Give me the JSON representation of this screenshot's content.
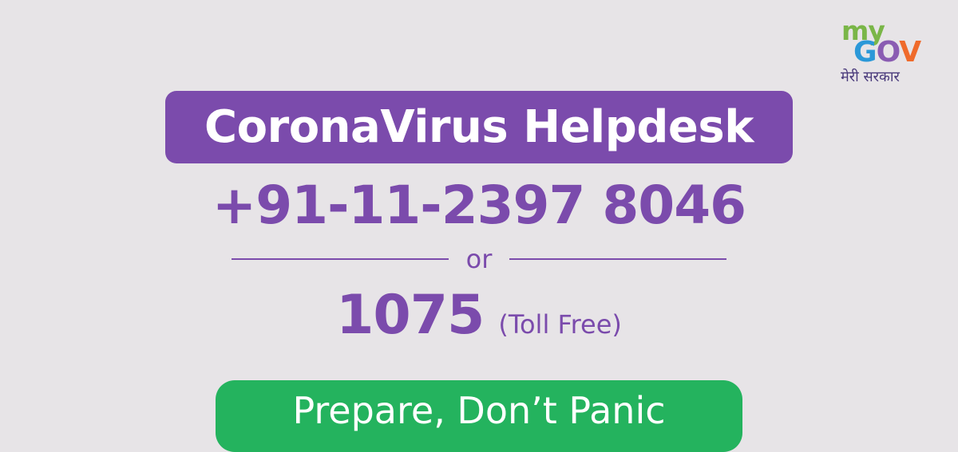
{
  "colors": {
    "background": "#e7e4e7",
    "purple": "#7b4bac",
    "green": "#24b35e",
    "logo_my": "#7ab648",
    "logo_g": "#2b98d8",
    "logo_o": "#8a5cb2",
    "logo_v": "#ef6a2b"
  },
  "logo": {
    "my": "my",
    "gov_g": "G",
    "gov_o": "O",
    "gov_v": "V",
    "hindi": "मेरी सरकार"
  },
  "title": "CoronaVirus Helpdesk",
  "phone": "+91-11-2397 8046",
  "separator": "or",
  "toll_free": {
    "number": "1075",
    "note": "(Toll Free)"
  },
  "slogan": "Prepare, Don’t Panic"
}
